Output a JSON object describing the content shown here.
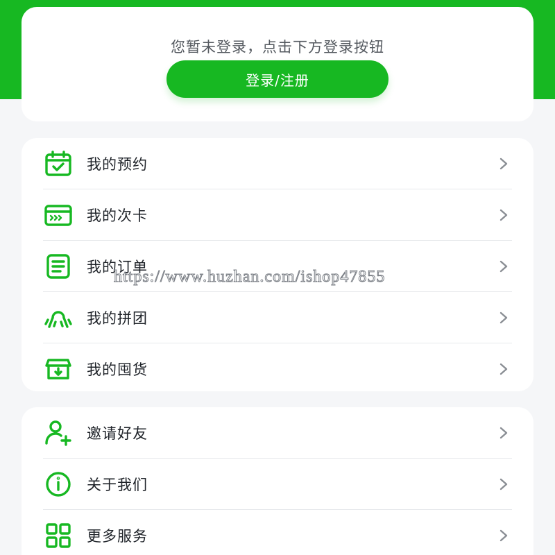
{
  "colors": {
    "accent": "#17b822",
    "background": "#f5f6f8",
    "card": "#ffffff",
    "text": "#1f2329",
    "hint": "#555a60",
    "chevron": "#8a8e94"
  },
  "login": {
    "hint": "您暂未登录，点击下方登录按钮",
    "button_label": "登录/注册"
  },
  "menu_group_1": [
    {
      "label": "我的预约",
      "icon": "calendar-check-icon"
    },
    {
      "label": "我的次卡",
      "icon": "card-icon"
    },
    {
      "label": "我的订单",
      "icon": "order-list-icon"
    },
    {
      "label": "我的拼团",
      "icon": "group-buy-icon"
    },
    {
      "label": "我的囤货",
      "icon": "stock-box-icon"
    }
  ],
  "menu_group_2": [
    {
      "label": "邀请好友",
      "icon": "invite-user-icon"
    },
    {
      "label": "关于我们",
      "icon": "info-icon"
    },
    {
      "label": "更多服务",
      "icon": "grid-apps-icon"
    }
  ],
  "watermark": "https://www.huzhan.com/ishop47855"
}
